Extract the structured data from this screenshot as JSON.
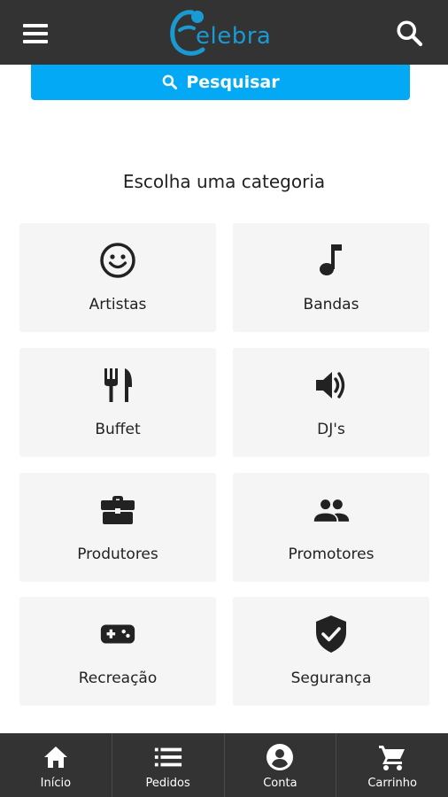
{
  "header": {
    "logo_text": "elebra",
    "brand_color": "#1a9ad3",
    "bar_color": "#333333",
    "menu_icon": "menu-icon",
    "search_icon": "search-icon"
  },
  "search": {
    "label": "Pesquisar",
    "color": "#03a9f4"
  },
  "categories": {
    "title": "Escolha uma categoria",
    "items": [
      {
        "label": "Artistas",
        "icon": "smiley-face-icon"
      },
      {
        "label": "Bandas",
        "icon": "music-note-icon"
      },
      {
        "label": "Buffet",
        "icon": "cutlery-icon"
      },
      {
        "label": "DJ's",
        "icon": "speaker-volume-icon"
      },
      {
        "label": "Produtores",
        "icon": "briefcase-icon"
      },
      {
        "label": "Promotores",
        "icon": "people-icon"
      },
      {
        "label": "Recreação",
        "icon": "gamepad-icon"
      },
      {
        "label": "Segurança",
        "icon": "shield-check-icon"
      }
    ]
  },
  "bottom_nav": {
    "items": [
      {
        "label": "Início",
        "icon": "home-icon"
      },
      {
        "label": "Pedidos",
        "icon": "list-icon"
      },
      {
        "label": "Conta",
        "icon": "account-icon"
      },
      {
        "label": "Carrinho",
        "icon": "cart-icon"
      }
    ]
  }
}
